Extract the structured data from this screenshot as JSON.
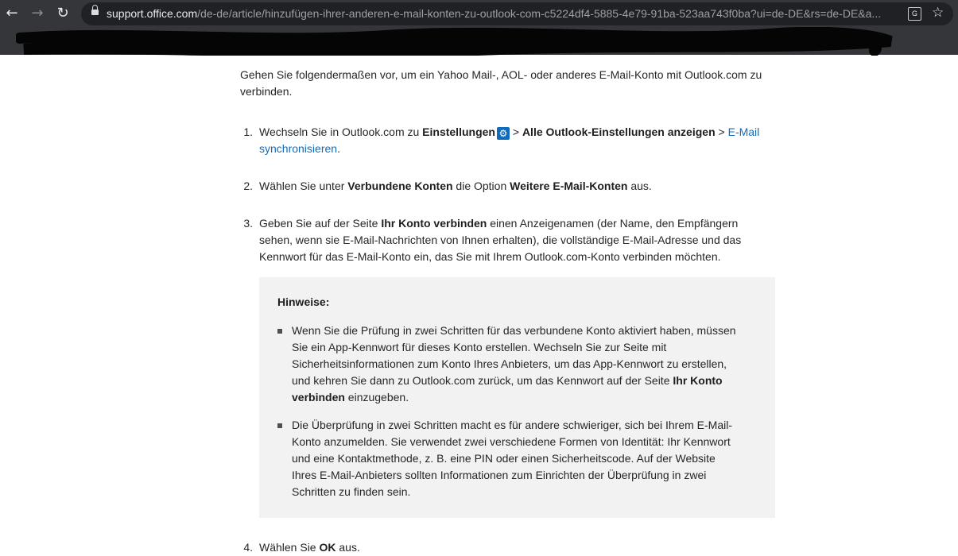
{
  "browser": {
    "url_host": "support.office.com",
    "url_path": "/de-de/article/hinzufügen-ihrer-anderen-e-mail-konten-zu-outlook-com-c5224df4-5885-4e79-91ba-523aa743f0ba?ui=de-DE&rs=de-DE&a...",
    "back_icon": "←",
    "forward_icon": "→",
    "reload_icon": "↻",
    "star_icon": "☆",
    "translate_icon": "G"
  },
  "article": {
    "intro": "Gehen Sie folgendermaßen vor, um ein Yahoo Mail-, AOL- oder anderes E-Mail-Konto mit Outlook.com zu verbinden.",
    "steps": [
      {
        "num": "1.",
        "t1": "Wechseln Sie in Outlook.com zu ",
        "b1": "Einstellungen",
        "gear": "⚙",
        "t2": " > ",
        "b2": "Alle Outlook-Einstellungen anzeigen",
        "t3": " > ",
        "link": "E-Mail synchronisieren",
        "t4": "."
      },
      {
        "num": "2.",
        "t1": "Wählen Sie unter ",
        "b1": "Verbundene Konten",
        "t2": " die Option ",
        "b2": "Weitere E-Mail-Konten",
        "t3": " aus."
      },
      {
        "num": "3.",
        "t1": "Geben Sie auf der Seite ",
        "b1": "Ihr Konto verbinden",
        "t2": " einen Anzeigenamen (der Name, den Empfängern sehen, wenn sie E-Mail-Nachrichten von Ihnen erhalten), die vollständige E-Mail-Adresse und das Kennwort für das E-Mail-Konto ein, das Sie mit Ihrem Outlook.com-Konto verbinden möchten."
      },
      {
        "num": "4.",
        "t1": "Wählen Sie ",
        "b1": "OK",
        "t2": " aus."
      }
    ],
    "notes": {
      "title": "Hinweise:",
      "item1_t1": "Wenn Sie die Prüfung in zwei Schritten für das verbundene Konto aktiviert haben, müssen Sie ein App-Kennwort für dieses Konto erstellen. Wechseln Sie zur Seite mit Sicherheitsinformationen zum Konto Ihres Anbieters, um das App-Kennwort zu erstellen, und kehren Sie dann zu Outlook.com zurück, um das Kennwort auf der Seite ",
      "item1_b1": "Ihr Konto verbinden",
      "item1_t2": " einzugeben.",
      "item2": "Die Überprüfung in zwei Schritten macht es für andere schwieriger, sich bei Ihrem E-Mail-Konto anzumelden. Sie verwendet zwei verschiedene Formen von Identität: Ihr Kennwort und eine Kontaktmethode, z. B. eine PIN oder einen Sicherheitscode. Auf der Website Ihres E-Mail-Anbieters sollten Informationen zum Einrichten der Überprüfung in zwei Schritten zu finden sein."
    }
  }
}
